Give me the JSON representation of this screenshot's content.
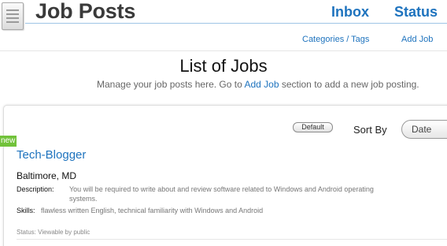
{
  "header": {
    "title": "Job Posts",
    "nav": {
      "inbox": "Inbox",
      "status": "Status"
    }
  },
  "subnav": {
    "categories": "Categories / Tags",
    "add_job": "Add Job"
  },
  "main": {
    "title": "List of Jobs",
    "subtitle_before": "Manage your job posts here. Go to ",
    "subtitle_link": "Add Job",
    "subtitle_after": " section to add a new job posting."
  },
  "toolbar": {
    "default_button": "Default",
    "sort_label": "Sort By",
    "sort_value": "Date"
  },
  "jobs": [
    {
      "badge": "new",
      "title": "Tech-Blogger",
      "location": "Baltimore, MD",
      "description_label": "Description:",
      "description": "You will be required to write about and review software related to Windows and Android operating systems.",
      "skills_label": "Skills:",
      "skills": "flawless written English, technical familiarity with Windows and Android",
      "status": "Status: Viewable by public"
    }
  ]
}
